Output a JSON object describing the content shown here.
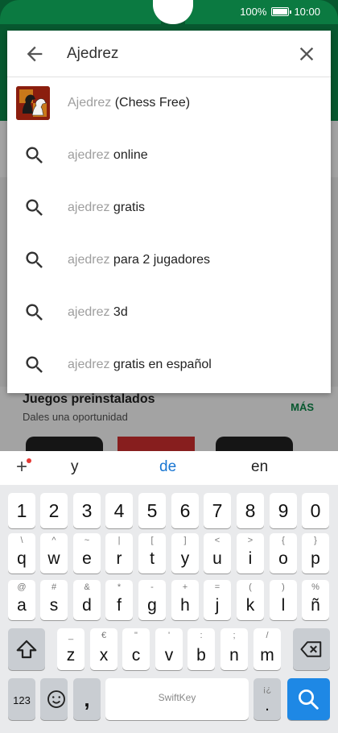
{
  "status_bar": {
    "battery": "100%",
    "battery_level": 1.0,
    "time": "10:00"
  },
  "search": {
    "query": "Ajedrez",
    "suggestions": [
      {
        "type": "app",
        "prefix": "Ajedrez",
        "suffix": " (Chess Free)"
      },
      {
        "type": "query",
        "prefix": "ajedrez",
        "suffix": " online"
      },
      {
        "type": "query",
        "prefix": "ajedrez",
        "suffix": " gratis"
      },
      {
        "type": "query",
        "prefix": "ajedrez",
        "suffix": " para 2 jugadores"
      },
      {
        "type": "query",
        "prefix": "ajedrez",
        "suffix": " 3d"
      },
      {
        "type": "query",
        "prefix": "ajedrez",
        "suffix": " gratis en español"
      }
    ]
  },
  "background": {
    "section_title": "Juegos preinstalados",
    "section_subtitle": "Dales una oportunidad",
    "more_label": "MÁS"
  },
  "keyboard": {
    "predictions": [
      "y",
      "de",
      "en"
    ],
    "numbers": [
      "1",
      "2",
      "3",
      "4",
      "5",
      "6",
      "7",
      "8",
      "9",
      "0"
    ],
    "row1": [
      {
        "main": "q",
        "sub": "\\"
      },
      {
        "main": "w",
        "sub": "^"
      },
      {
        "main": "e",
        "sub": "~"
      },
      {
        "main": "r",
        "sub": "|"
      },
      {
        "main": "t",
        "sub": "["
      },
      {
        "main": "y",
        "sub": "]"
      },
      {
        "main": "u",
        "sub": "<"
      },
      {
        "main": "i",
        "sub": ">"
      },
      {
        "main": "o",
        "sub": "{"
      },
      {
        "main": "p",
        "sub": "}"
      }
    ],
    "row2": [
      {
        "main": "a",
        "sub": "@"
      },
      {
        "main": "s",
        "sub": "#"
      },
      {
        "main": "d",
        "sub": "&"
      },
      {
        "main": "f",
        "sub": "*"
      },
      {
        "main": "g",
        "sub": "-"
      },
      {
        "main": "h",
        "sub": "+"
      },
      {
        "main": "j",
        "sub": "="
      },
      {
        "main": "k",
        "sub": "("
      },
      {
        "main": "l",
        "sub": ")"
      },
      {
        "main": "ñ",
        "sub": "%"
      }
    ],
    "row3": [
      {
        "main": "z",
        "sub": "_"
      },
      {
        "main": "x",
        "sub": "€"
      },
      {
        "main": "c",
        "sub": "\""
      },
      {
        "main": "v",
        "sub": "'"
      },
      {
        "main": "b",
        "sub": ":"
      },
      {
        "main": "n",
        "sub": ";"
      },
      {
        "main": "m",
        "sub": "/"
      }
    ],
    "bottom": {
      "symbols_label": "123",
      "comma": ",",
      "space_logo": "SwiftKey",
      "period": ".",
      "period_sub": "¡¿"
    }
  },
  "colors": {
    "accent": "#0b8a4a",
    "highlight": "#1976d2",
    "search_key": "#1e88e5"
  }
}
